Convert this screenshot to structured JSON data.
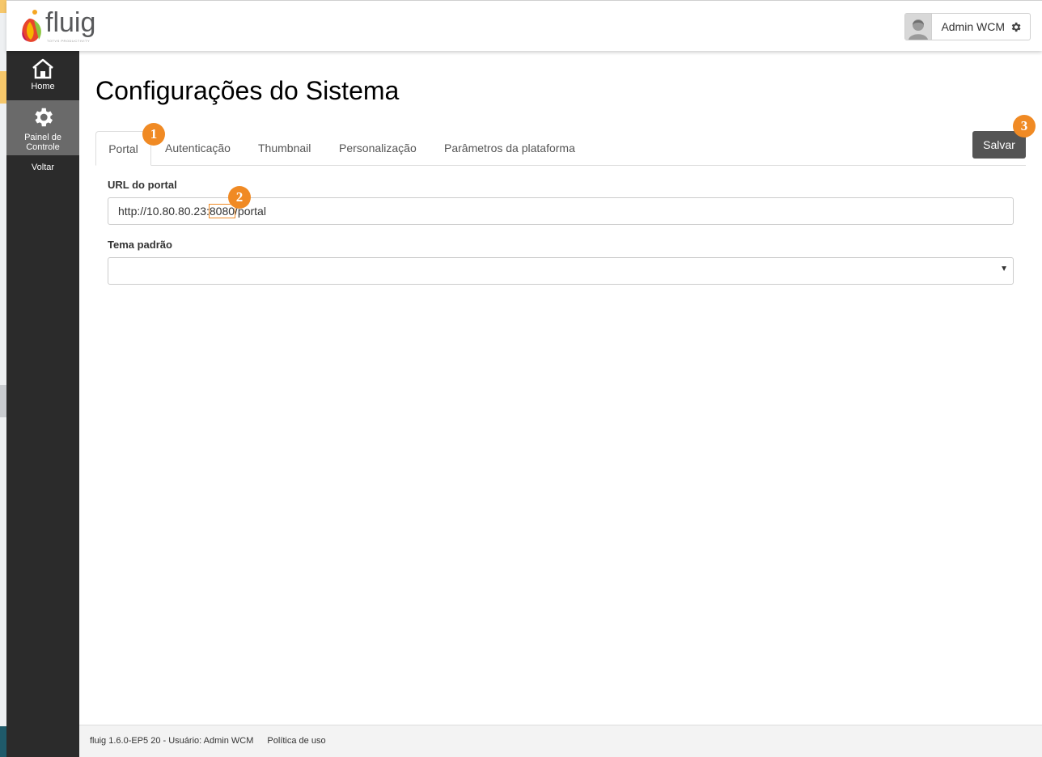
{
  "header": {
    "logo_text": "fluig",
    "logo_subtext": "TOTVS PRODUCTIVITY",
    "user_name": "Admin WCM",
    "user_icon": "user-avatar-icon",
    "settings_icon": "gear-icon"
  },
  "sidebar": {
    "items": [
      {
        "label": "Home",
        "icon": "home-icon"
      },
      {
        "label": "Painel de Controle",
        "icon": "gear-icon"
      },
      {
        "label": "Voltar"
      }
    ]
  },
  "main": {
    "title": "Configurações do Sistema",
    "tabs": [
      {
        "label": "Portal",
        "active": true
      },
      {
        "label": "Autenticação"
      },
      {
        "label": "Thumbnail"
      },
      {
        "label": "Personalização"
      },
      {
        "label": "Parâmetros da plataforma"
      }
    ],
    "save_label": "Salvar",
    "url_label": "URL do portal",
    "url_value_prefix": "http://10.80.80.23:",
    "url_value_port": "8080",
    "url_value_suffix": "/portal",
    "theme_label": "Tema padrão",
    "theme_value": ""
  },
  "callouts": [
    "1",
    "2",
    "3"
  ],
  "footer": {
    "version_text": "fluig 1.6.0-EP5 20 - Usuário: Admin WCM",
    "policy_link": "Política de uso"
  },
  "colors": {
    "sidebar_bg": "#2b2b2b",
    "sidebar_active": "#6a6a6a",
    "save_button": "#545454",
    "callout": "#f08a24"
  }
}
